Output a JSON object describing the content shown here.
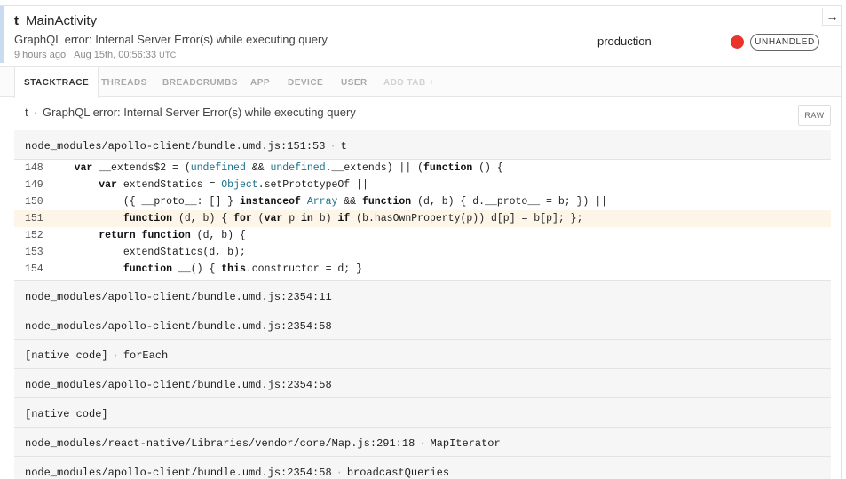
{
  "header": {
    "function_name": "t",
    "title": "MainActivity",
    "message": "GraphQL error: Internal Server Error(s) while executing query",
    "relative_time": "9 hours ago",
    "timestamp": "Aug 15th, 00:56:33",
    "timezone": "UTC",
    "environment": "production",
    "status": "UNHANDLED",
    "status_color": "#e8352b",
    "nav_icon": "arrow-right-icon",
    "nav_glyph": "→"
  },
  "tabs": [
    {
      "label": "STACKTRACE",
      "active": true
    },
    {
      "label": "THREADS"
    },
    {
      "label": "BREADCRUMBS"
    },
    {
      "label": "APP"
    },
    {
      "label": "DEVICE"
    },
    {
      "label": "USER"
    },
    {
      "label": "ADD TAB +"
    }
  ],
  "exception": {
    "class": "t",
    "separator": "·",
    "message": "GraphQL error: Internal Server Error(s) while executing query",
    "raw_label": "RAW"
  },
  "frames": [
    {
      "file": "node_modules/apollo-client/bundle.umd.js:151:53",
      "method": "t",
      "expanded": true
    },
    {
      "file": "node_modules/apollo-client/bundle.umd.js:2354:11",
      "method": ""
    },
    {
      "file": "node_modules/apollo-client/bundle.umd.js:2354:58",
      "method": ""
    },
    {
      "file": "[native code]",
      "method": "forEach"
    },
    {
      "file": "node_modules/apollo-client/bundle.umd.js:2354:58",
      "method": ""
    },
    {
      "file": "[native code]",
      "method": ""
    },
    {
      "file": "node_modules/react-native/Libraries/vendor/core/Map.js:291:18",
      "method": "MapIterator"
    },
    {
      "file": "node_modules/apollo-client/bundle.umd.js:2354:58",
      "method": "broadcastQueries"
    }
  ],
  "code_context": {
    "highlight_line": "151",
    "lines": [
      {
        "n": "148",
        "code": "    var __extends$2 = (undefined && undefined.__extends) || (function () {"
      },
      {
        "n": "149",
        "code": "        var extendStatics = Object.setPrototypeOf ||"
      },
      {
        "n": "150",
        "code": "            ({ __proto__: [] } instanceof Array && function (d, b) { d.__proto__ = b; }) ||"
      },
      {
        "n": "151",
        "code": "            function (d, b) { for (var p in b) if (b.hasOwnProperty(p)) d[p] = b[p]; };"
      },
      {
        "n": "152",
        "code": "        return function (d, b) {"
      },
      {
        "n": "153",
        "code": "            extendStatics(d, b);"
      },
      {
        "n": "154",
        "code": "            function __() { this.constructor = d; }"
      }
    ]
  }
}
